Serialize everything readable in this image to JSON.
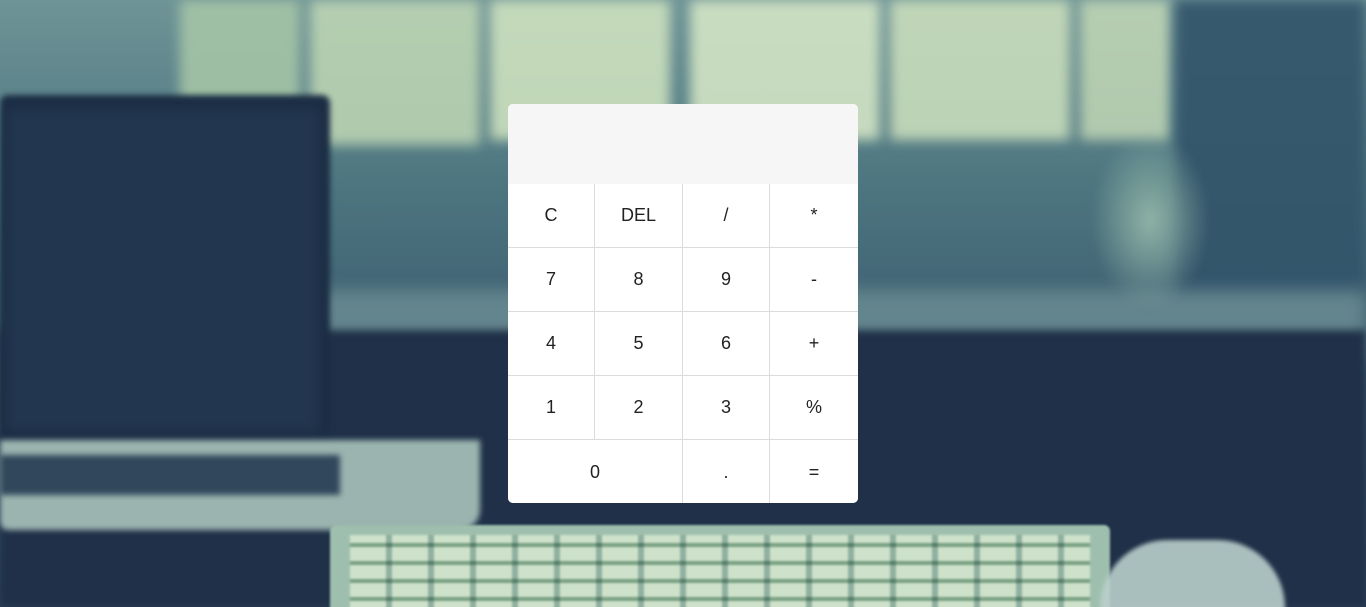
{
  "display": {
    "value": ""
  },
  "keys": {
    "clear": "C",
    "delete": "DEL",
    "divide": "/",
    "multiply": "*",
    "seven": "7",
    "eight": "8",
    "nine": "9",
    "minus": "-",
    "four": "4",
    "five": "5",
    "six": "6",
    "plus": "+",
    "one": "1",
    "two": "2",
    "three": "3",
    "percent": "%",
    "zero": "0",
    "decimal": ".",
    "equals": "="
  },
  "colors": {
    "calculator_bg": "#ffffff",
    "display_bg": "#f6f6f6",
    "key_border": "#dcdcdc"
  }
}
